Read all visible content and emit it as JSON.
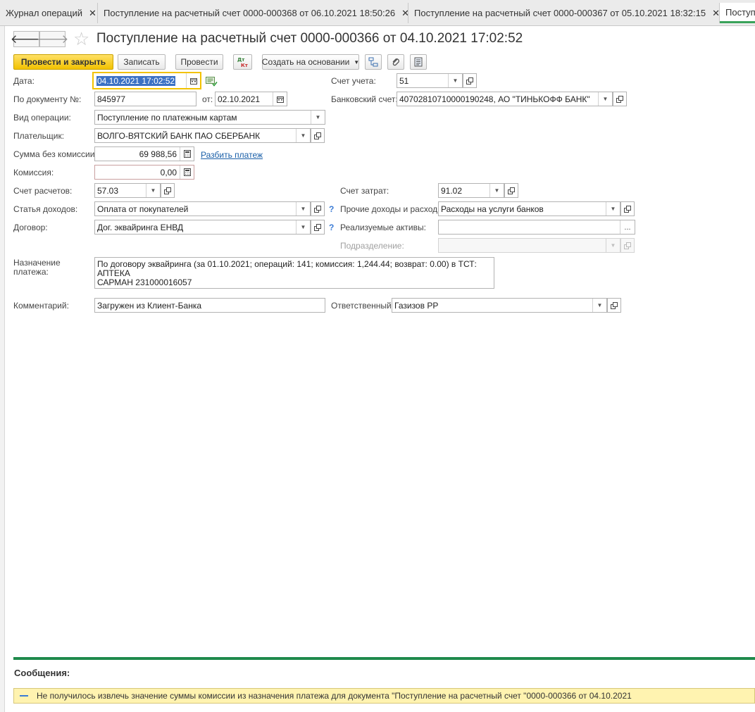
{
  "tabs": [
    {
      "label": "Журнал операций"
    },
    {
      "label": "Поступление на расчетный счет 0000-000368 от 06.10.2021 18:50:26"
    },
    {
      "label": "Поступление на расчетный счет 0000-000367 от 05.10.2021 18:32:15"
    },
    {
      "label": "Поступлен"
    }
  ],
  "header": {
    "title": "Поступление на расчетный счет 0000-000366 от 04.10.2021 17:02:52"
  },
  "toolbar": {
    "post_close": "Провести и закрыть",
    "save": "Записать",
    "post": "Провести",
    "create_based": "Создать на основании"
  },
  "form": {
    "date_label": "Дата:",
    "date_value": "04.10.2021 17:02:52",
    "doc_no_label": "По документу №:",
    "doc_no_value": "845977",
    "from_label": "от:",
    "from_value": "02.10.2021",
    "op_type_label": "Вид операции:",
    "op_type_value": "Поступление по платежным картам",
    "payer_label": "Плательщик:",
    "payer_value": "ВОЛГО-ВЯТСКИЙ БАНК ПАО СБЕРБАНК",
    "sum_label": "Сумма без комиссии:",
    "sum_value": "69 988,56",
    "split_link": "Разбить платеж",
    "commission_label": "Комиссия:",
    "commission_value": "0,00",
    "settle_label": "Счет расчетов:",
    "settle_value": "57.03",
    "income_label": "Статья доходов:",
    "income_value": "Оплата от покупателей",
    "contract_label": "Договор:",
    "contract_value": "Дог. эквайринга ЕНВД",
    "account_label": "Счет учета:",
    "account_value": "51",
    "bank_label": "Банковский счет:",
    "bank_value": "40702810710000190248, АО \"ТИНЬКОФФ БАНК\"",
    "cost_account_label": "Счет затрат:",
    "cost_account_value": "91.02",
    "other_label": "Прочие доходы и расходы:",
    "other_value": "Расходы на услуги банков",
    "assets_label": "Реализуемые активы:",
    "assets_value": "",
    "division_label": "Подразделение:",
    "division_value": "",
    "purpose_label_1": "Назначение",
    "purpose_label_2": "платежа:",
    "purpose_line1": "По договору эквайринга (за 01.10.2021; операций: 141; комиссия: 1,244.44;  возврат: 0.00) в ТСТ: АПТЕКА",
    "purpose_line2": "САРМАН 231000016057",
    "comment_label": "Комментарий:",
    "comment_value": "Загружен из Клиент-Банка",
    "responsible_label": "Ответственный:",
    "responsible_value": "Газизов РР"
  },
  "messages": {
    "title": "Сообщения:",
    "text": "Не получилось извлечь значение суммы комиссии из назначения платежа для документа \"Поступление на расчетный счет \"0000-000366 от 04.10.2021"
  },
  "icons": [
    "close-icon",
    "back-arrow-icon",
    "forward-arrow-icon",
    "star-icon",
    "dt-kt-icon",
    "structure-icon",
    "paperclip-icon",
    "report-icon",
    "calendar-icon",
    "calculator-icon",
    "open-icon",
    "dropdown-icon",
    "help-icon",
    "history-icon"
  ],
  "colors": {
    "accent_yellow": "#f2c200",
    "green_accent": "#1f8a4c",
    "link_blue": "#1a5fa8",
    "message_bg": "#fff3b0"
  }
}
